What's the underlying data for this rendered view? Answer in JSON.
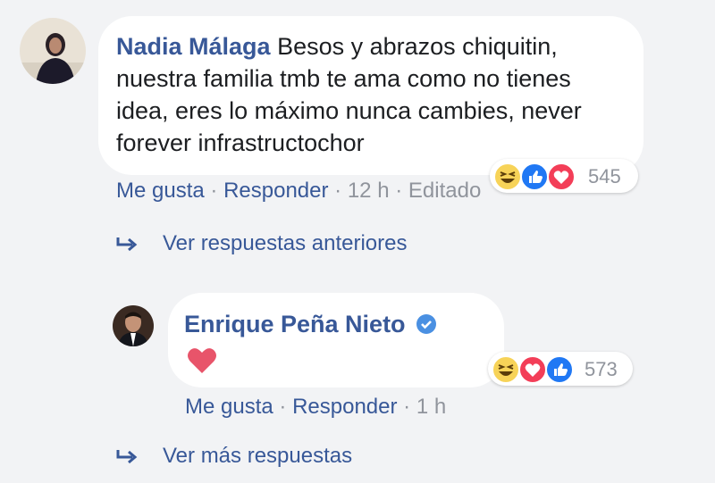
{
  "comment1": {
    "author": "Nadia Málaga",
    "text": "Besos y abrazos chiquitin, nuestra familia tmb te ama como no tienes idea, eres lo máximo nunca cambies, never forever infrastructochor",
    "reaction_count": "545",
    "reactions": [
      "haha-icon",
      "like-icon",
      "love-icon"
    ],
    "like_label": "Me gusta",
    "reply_label": "Responder",
    "time": "12 h",
    "edited_label": "Editado"
  },
  "previous_replies_label": "Ver respuestas anteriores",
  "reply1": {
    "author": "Enrique Peña Nieto",
    "verified": true,
    "text": "",
    "content_icon": "heart-emoji-icon",
    "reaction_count": "573",
    "reactions": [
      "haha-icon",
      "love-icon",
      "like-icon"
    ],
    "like_label": "Me gusta",
    "reply_label": "Responder",
    "time": "1 h"
  },
  "more_replies_label": "Ver más respuestas",
  "colors": {
    "link_blue": "#385898",
    "meta_gray": "#90949c",
    "background": "#f2f3f5",
    "like_blue": "#2078f4",
    "love_red": "#f33e58",
    "haha_yellow": "#f7d358"
  }
}
